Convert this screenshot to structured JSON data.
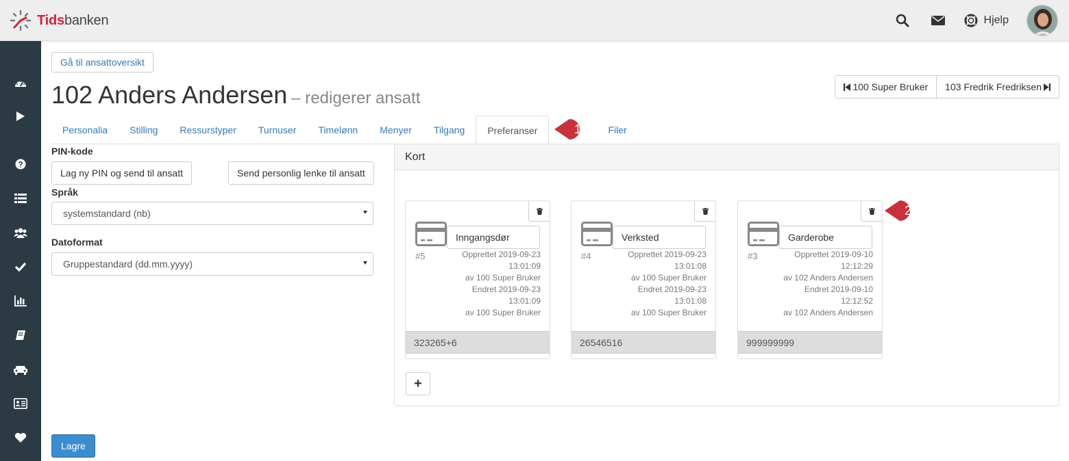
{
  "app": {
    "logo_first": "Tids",
    "logo_second": "banken",
    "help_label": "Hjelp"
  },
  "icons": {
    "search": "search-icon",
    "mail": "envelope-icon",
    "help": "lifebuoy-icon"
  },
  "sidebar": {
    "items": [
      {
        "icon": "dashboard-icon"
      },
      {
        "icon": "play-icon"
      },
      {
        "icon": "question-icon"
      },
      {
        "icon": "list-icon"
      },
      {
        "icon": "users-icon"
      },
      {
        "icon": "check-icon"
      },
      {
        "icon": "chart-icon"
      },
      {
        "icon": "book-icon"
      },
      {
        "icon": "car-icon"
      },
      {
        "icon": "id-card-icon"
      },
      {
        "icon": "heart-icon"
      }
    ]
  },
  "page": {
    "back_label": "Gå til ansattoversikt",
    "title": "102 Anders Andersen",
    "subtitle": "– redigerer ansatt",
    "prev_employee": "100 Super Bruker",
    "next_employee": "103 Fredrik Fredriksen"
  },
  "tabs": [
    {
      "label": "Personalia"
    },
    {
      "label": "Stilling"
    },
    {
      "label": "Ressurstyper"
    },
    {
      "label": "Turnuser"
    },
    {
      "label": "Timelønn"
    },
    {
      "label": "Menyer"
    },
    {
      "label": "Tilgang"
    },
    {
      "label": "Preferanser",
      "active": true
    },
    {
      "label": "Filer"
    }
  ],
  "callouts": {
    "first": "1",
    "second": "2",
    "color": "#c9323d"
  },
  "form": {
    "pin_label": "PIN-kode",
    "new_pin_button": "Lag ny PIN og send til ansatt",
    "send_link_button": "Send personlig lenke til ansatt",
    "language_label": "Språk",
    "language_value": "systemstandard (nb)",
    "dateformat_label": "Datoformat",
    "dateformat_value": "Gruppestandard (dd.mm.yyyy)"
  },
  "cards_panel": {
    "title": "Kort",
    "cards": [
      {
        "name": "Inngangsdør",
        "number": "#5",
        "meta": [
          "Opprettet 2019-09-23",
          "13:01:09",
          "av 100 Super Bruker",
          "Endret 2019-09-23",
          "13:01:09",
          "av 100 Super Bruker"
        ],
        "card_id": "323265+6"
      },
      {
        "name": "Verksted",
        "number": "#4",
        "meta": [
          "Opprettet 2019-09-23",
          "13:01:08",
          "av 100 Super Bruker",
          "Endret 2019-09-23",
          "13:01:08",
          "av 100 Super Bruker"
        ],
        "card_id": "26546516"
      },
      {
        "name": "Garderobe",
        "number": "#3",
        "meta": [
          "Opprettet 2019-09-10",
          "12:12:29",
          "av 102 Anders Andersen",
          "Endret 2019-09-10",
          "12:12:52",
          "av 102 Anders Andersen"
        ],
        "card_id": "999999999"
      }
    ],
    "add_label": "+"
  },
  "save_label": "Lagre"
}
